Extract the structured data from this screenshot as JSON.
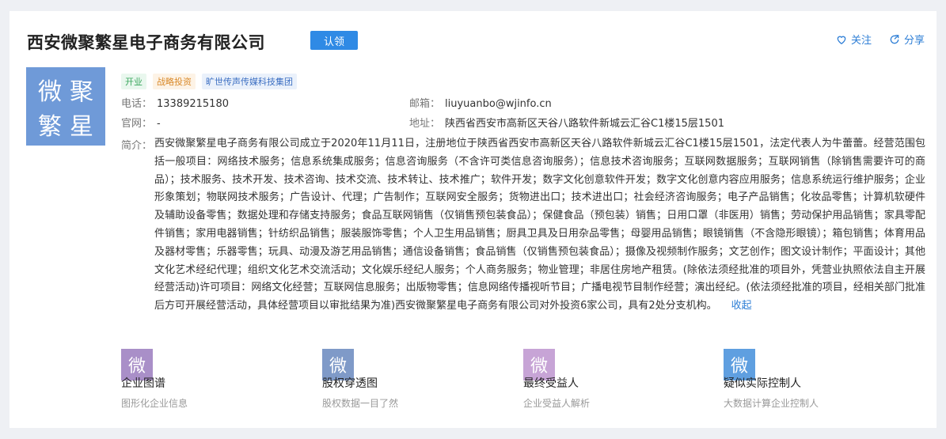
{
  "company": {
    "name": "西安微聚繁星电子商务有限公司",
    "claim_label": "认领",
    "logo_chars": [
      "微",
      "聚",
      "繁",
      "星"
    ],
    "logo_color": "#6f9ad8"
  },
  "actions": {
    "follow": "关注",
    "share": "分享"
  },
  "tags": [
    "开业",
    "战略投资",
    "旷世传声传媒科技集团"
  ],
  "contact": {
    "phone_label": "电话：",
    "phone": "13389215180",
    "email_label": "邮箱：",
    "email": "liuyuanbo@wjinfo.cn",
    "website_label": "官网：",
    "website": "-",
    "address_label": "地址：",
    "address": "陕西省西安市高新区天谷八路软件新城云汇谷C1楼15层1501"
  },
  "intro": {
    "label": "简介：",
    "text": "西安微聚繁星电子商务有限公司成立于2020年11月11日，注册地位于陕西省西安市高新区天谷八路软件新城云汇谷C1楼15层1501，法定代表人为牛蕾蕾。经营范围包括一般项目：网络技术服务；信息系统集成服务；信息咨询服务（不含许可类信息咨询服务）；信息技术咨询服务；互联网数据服务；互联网销售（除销售需要许可的商品）；技术服务、技术开发、技术咨询、技术交流、技术转让、技术推广；软件开发；数字文化创意软件开发；数字文化创意内容应用服务；信息系统运行维护服务；企业形象策划；物联网技术服务；广告设计、代理；广告制作；互联网安全服务；货物进出口；技术进出口；社会经济咨询服务；电子产品销售；化妆品零售；计算机软硬件及辅助设备零售；数据处理和存储支持服务；食品互联网销售（仅销售预包装食品）；保健食品（预包装）销售；日用口罩（非医用）销售；劳动保护用品销售；家具零配件销售；家用电器销售；针纺织品销售；服装服饰零售；个人卫生用品销售；厨具卫具及日用杂品零售；母婴用品销售；眼镜销售（不含隐形眼镜）；箱包销售；体育用品及器材零售；乐器零售；玩具、动漫及游艺用品销售；通信设备销售；食品销售（仅销售预包装食品）；摄像及视频制作服务；文艺创作；图文设计制作；平面设计；其他文化艺术经纪代理；组织文化艺术交流活动；文化娱乐经纪人服务；个人商务服务；物业管理；非居住房地产租赁。(除依法须经批准的项目外，凭营业执照依法自主开展经营活动)许可项目：网络文化经营；互联网信息服务；出版物零售；信息网络传播视听节目；广播电视节目制作经营；演出经纪。(依法须经批准的项目，经相关部门批准后方可开展经营活动，具体经营项目以审批结果为准)西安微聚繁星电子商务有限公司对外投资6家公司，具有2处分支机构。",
    "collapse_label": "收起"
  },
  "features": [
    {
      "icon_char": "微",
      "color": "#a98fc8",
      "title": "企业图谱",
      "subtitle": "图形化企业信息"
    },
    {
      "icon_char": "微",
      "color": "#7f9ac8",
      "title": "股权穿透图",
      "subtitle": "股权数据一目了然"
    },
    {
      "icon_char": "微",
      "color": "#c7a4d6",
      "title": "最终受益人",
      "subtitle": "企业受益人解析"
    },
    {
      "icon_char": "微",
      "color": "#5f9fe0",
      "title": "疑似实际控制人",
      "subtitle": "大数据计算企业控制人"
    }
  ]
}
